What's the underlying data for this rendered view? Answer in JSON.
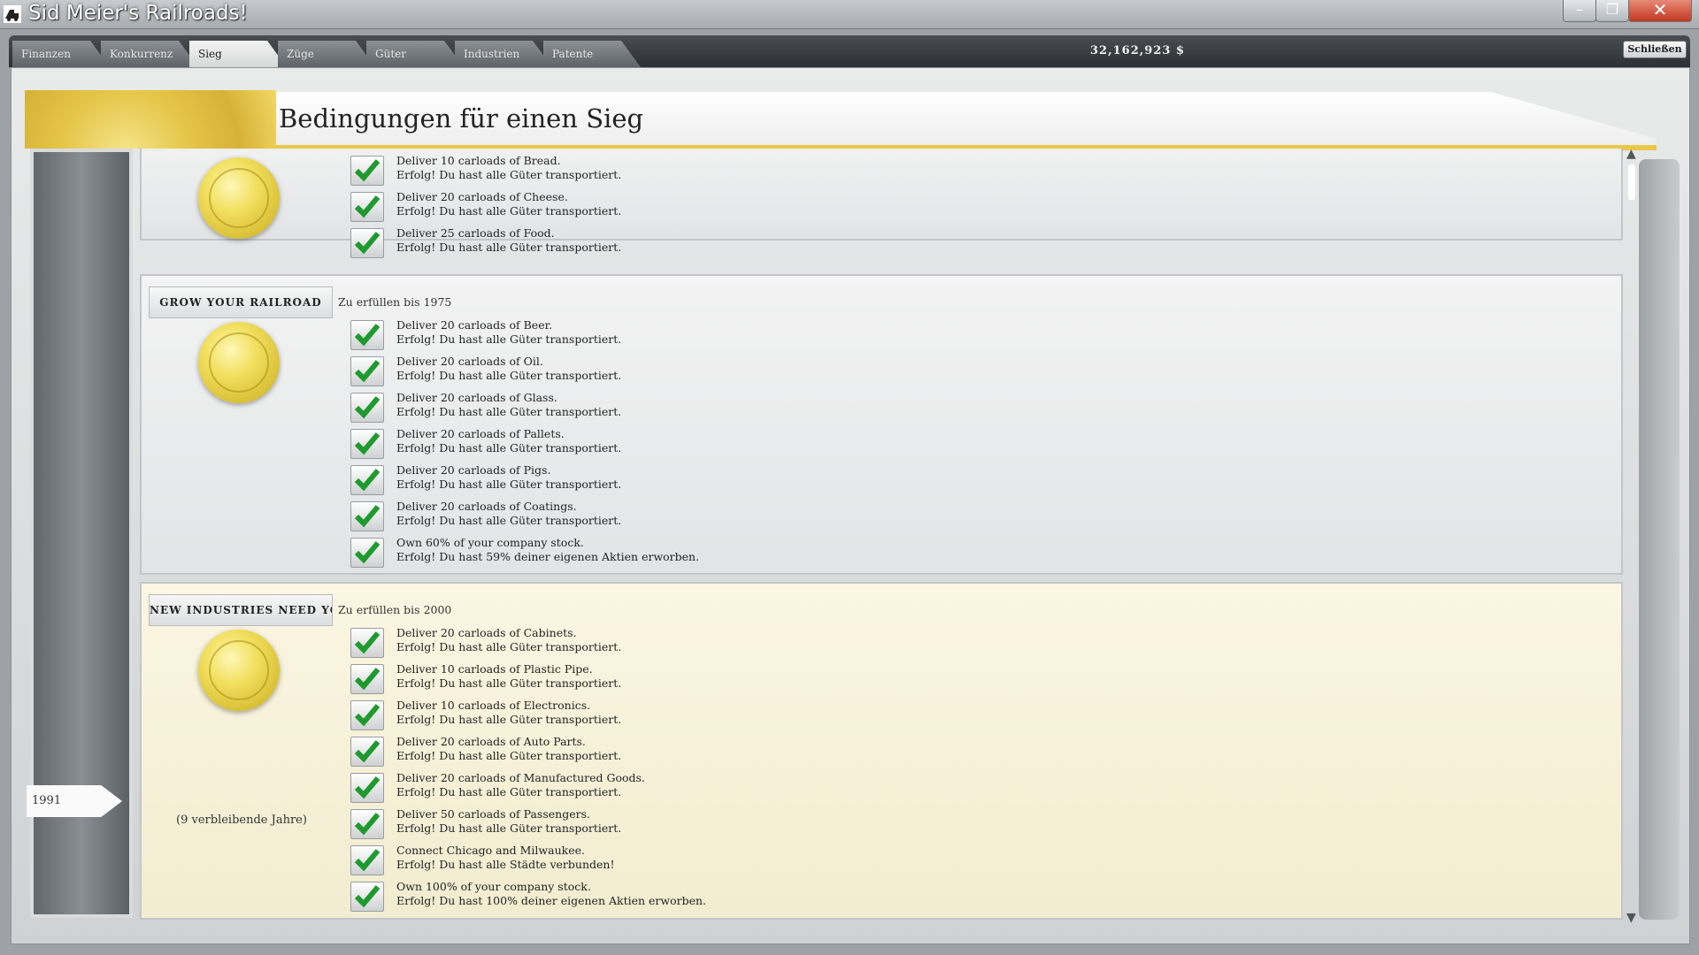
{
  "window": {
    "title": "Sid Meier's Railroads!",
    "min": "–",
    "max": "❐",
    "close": "✕"
  },
  "tabs": [
    "Finanzen",
    "Konkurrenz",
    "Sieg",
    "Züge",
    "Güter",
    "Industrien",
    "Patente"
  ],
  "active_tab": "Sieg",
  "money": "32,162,923 $",
  "close_label": "Schließen",
  "page_title": "Bedingungen für einen Sieg",
  "timeline": {
    "year": "1991"
  },
  "sections": [
    {
      "name": "",
      "deadline": "",
      "conditions": [
        {
          "task": "Deliver 10 carloads of Bread.",
          "status": "Erfolg! Du hast alle Güter transportiert."
        },
        {
          "task": "Deliver 20 carloads of Cheese.",
          "status": "Erfolg! Du hast alle Güter transportiert."
        },
        {
          "task": "Deliver 25 carloads of Food.",
          "status": "Erfolg! Du hast alle Güter transportiert."
        }
      ]
    },
    {
      "name": "GROW YOUR RAILROAD",
      "deadline": "Zu erfüllen bis 1975",
      "conditions": [
        {
          "task": "Deliver 20 carloads of Beer.",
          "status": "Erfolg! Du hast alle Güter transportiert."
        },
        {
          "task": "Deliver 20 carloads of Oil.",
          "status": "Erfolg! Du hast alle Güter transportiert."
        },
        {
          "task": "Deliver 20 carloads of Glass.",
          "status": "Erfolg! Du hast alle Güter transportiert."
        },
        {
          "task": "Deliver 20 carloads of Pallets.",
          "status": "Erfolg! Du hast alle Güter transportiert."
        },
        {
          "task": "Deliver 20 carloads of Pigs.",
          "status": "Erfolg! Du hast alle Güter transportiert."
        },
        {
          "task": "Deliver 20 carloads of Coatings.",
          "status": "Erfolg! Du hast alle Güter transportiert."
        },
        {
          "task": "Own 60% of your company stock.",
          "status": "Erfolg! Du hast 59% deiner eigenen Aktien erworben."
        }
      ]
    },
    {
      "name": "NEW INDUSTRIES NEED YOUR RA",
      "deadline": "Zu erfüllen bis 2000",
      "remaining": "(9 verbleibende Jahre)",
      "conditions": [
        {
          "task": "Deliver 20 carloads of Cabinets.",
          "status": "Erfolg! Du hast alle Güter transportiert."
        },
        {
          "task": "Deliver 10 carloads of Plastic Pipe.",
          "status": "Erfolg! Du hast alle Güter transportiert."
        },
        {
          "task": "Deliver 10 carloads of Electronics.",
          "status": "Erfolg! Du hast alle Güter transportiert."
        },
        {
          "task": "Deliver 20 carloads of Auto Parts.",
          "status": "Erfolg! Du hast alle Güter transportiert."
        },
        {
          "task": "Deliver 20 carloads of Manufactured Goods.",
          "status": "Erfolg! Du hast alle Güter transportiert."
        },
        {
          "task": "Deliver 50 carloads of Passengers.",
          "status": "Erfolg! Du hast alle Güter transportiert."
        },
        {
          "task": "Connect Chicago and Milwaukee.",
          "status": "Erfolg! Du hast alle Städte verbunden!"
        },
        {
          "task": "Own 100% of your company stock.",
          "status": "Erfolg! Du hast 100% deiner eigenen Aktien erworben."
        }
      ]
    }
  ],
  "colors": {
    "accent_gold": "#e9c84a",
    "check_green": "#1f9a2e"
  }
}
